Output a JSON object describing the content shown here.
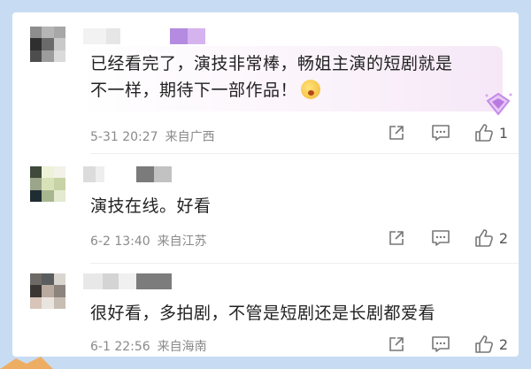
{
  "comments": [
    {
      "text_line1": "已经看完了，演技非常棒，畅姐主演的短剧就是",
      "text_line2": "不一样，期待下一部作品！",
      "emoji_icon": "shocked-face-emoji",
      "date": "5-31 20:27",
      "location": "来自广西",
      "like_count": "1"
    },
    {
      "text": "演技在线。好看",
      "date": "6-2 13:40",
      "location": "来自江苏",
      "like_count": "2"
    },
    {
      "text": "很好看，多拍剧，不管是短剧还是长剧都爱看",
      "date": "6-1 22:56",
      "location": "来自海南",
      "like_count": "2"
    }
  ],
  "colors": {
    "background": "#c7dcf3",
    "meta_text": "#8a8a8a",
    "icon": "#777777",
    "badge_accent": "#c58be8"
  },
  "icons": [
    "share-icon",
    "comment-icon",
    "like-icon",
    "diamond-badge-icon"
  ]
}
